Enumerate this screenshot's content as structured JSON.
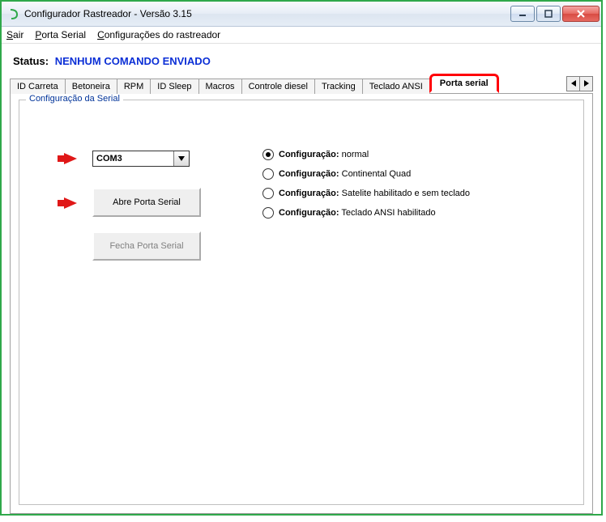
{
  "window": {
    "title": "Configurador Rastreador - Versão 3.15"
  },
  "menu": {
    "sair": "Sair",
    "porta_serial": "Porta Serial",
    "config_rastreador": "Configurações do rastreador"
  },
  "status": {
    "label": "Status:",
    "value": "NENHUM COMANDO ENVIADO"
  },
  "tabs": {
    "items": [
      {
        "label": "ID Carreta"
      },
      {
        "label": "Betoneira"
      },
      {
        "label": "RPM"
      },
      {
        "label": "ID Sleep"
      },
      {
        "label": "Macros"
      },
      {
        "label": "Controle diesel"
      },
      {
        "label": "Tracking"
      },
      {
        "label": "Teclado ANSI"
      },
      {
        "label": "Porta serial"
      }
    ],
    "active_index": 8
  },
  "serial": {
    "group_title": "Configuração da Serial",
    "port_value": "COM3",
    "open_button": "Abre Porta Serial",
    "close_button": "Fecha Porta Serial",
    "radio_prefix": "Configuração:",
    "options": [
      {
        "label": "normal",
        "selected": true
      },
      {
        "label": "Continental Quad",
        "selected": false
      },
      {
        "label": "Satelite habilitado e sem teclado",
        "selected": false
      },
      {
        "label": "Teclado ANSI habilitado",
        "selected": false
      }
    ]
  }
}
